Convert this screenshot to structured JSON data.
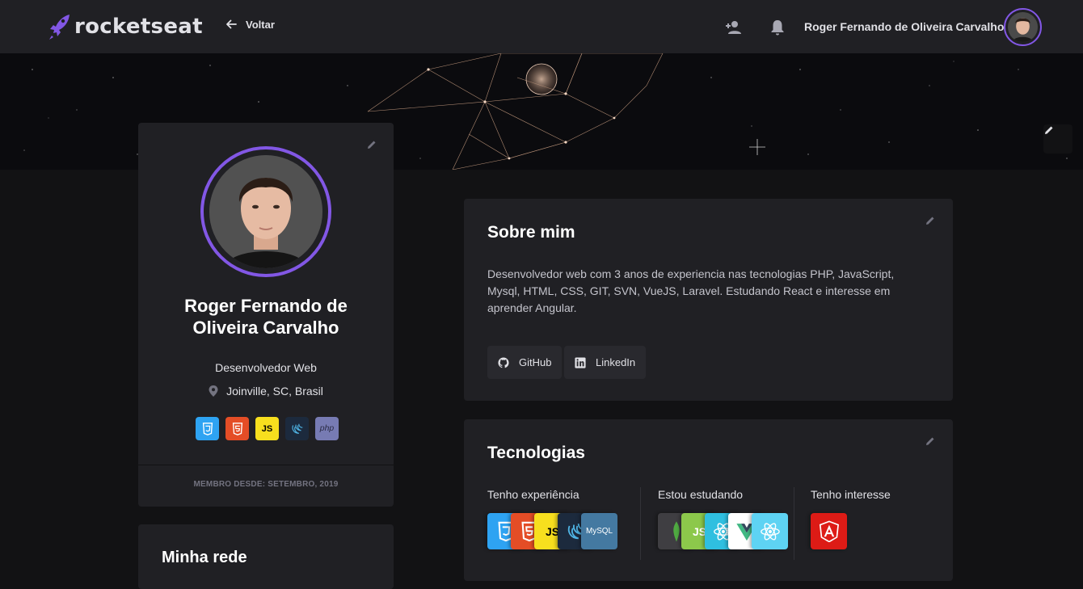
{
  "header": {
    "brand": "rocketseat",
    "back_label": "Voltar",
    "user_name": "Roger Fernando de Oliveira Carvalho",
    "accent": "#8257e5"
  },
  "banner": {
    "edit_icon": "pencil-icon"
  },
  "profile": {
    "name": "Roger Fernando de Oliveira Carvalho",
    "role": "Desenvolvedor Web",
    "location": "Joinville, SC, Brasil",
    "technologies": [
      {
        "label": "",
        "icon": "css3-icon",
        "bg": "#2ea3f2",
        "fg": "#ffffff"
      },
      {
        "label": "",
        "icon": "html5-icon",
        "bg": "#e44d26",
        "fg": "#ffffff"
      },
      {
        "label": "JS",
        "icon": "javascript-icon",
        "bg": "#f7df1e",
        "fg": "#000000"
      },
      {
        "label": "",
        "icon": "jquery-icon",
        "bg": "#1c2a3d",
        "fg": "#4fb4e4"
      },
      {
        "label": "php",
        "icon": "php-icon",
        "bg": "#777bb3",
        "fg": "#2a2b44"
      }
    ],
    "member_since": "MEMBRO DESDE: SETEMBRO, 2019"
  },
  "network": {
    "title": "Minha rede"
  },
  "about": {
    "title": "Sobre mim",
    "text": "Desenvolvedor web com 3 anos de experiencia nas tecnologias PHP, JavaScript, Mysql, HTML, CSS, GIT, SVN, VueJS, Laravel. Estudando React e interesse em aprender Angular.",
    "links": [
      {
        "label": "GitHub",
        "icon": "github-icon"
      },
      {
        "label": "LinkedIn",
        "icon": "linkedin-icon"
      }
    ]
  },
  "technologies": {
    "title": "Tecnologias",
    "columns": [
      {
        "label": "Tenho experiência",
        "items": [
          {
            "label": "",
            "icon": "css3-icon",
            "bg": "#2ea3f2",
            "fg": "#ffffff"
          },
          {
            "label": "",
            "icon": "html5-icon",
            "bg": "#e44d26",
            "fg": "#ffffff"
          },
          {
            "label": "JS",
            "icon": "javascript-icon",
            "bg": "#f7df1e",
            "fg": "#000000"
          },
          {
            "label": "",
            "icon": "jquery-icon",
            "bg": "#1c2a3d",
            "fg": "#4fb4e4"
          },
          {
            "label": "MySQL",
            "icon": "mysql-icon",
            "bg": "#4479a1",
            "fg": "#ffffff"
          }
        ]
      },
      {
        "label": "Estou estudando",
        "items": [
          {
            "label": "",
            "icon": "mongodb-icon",
            "bg": "#3f3e42",
            "fg": "#4faa41"
          },
          {
            "label": "JS",
            "icon": "nodejs-icon",
            "bg": "#8cc84b",
            "fg": "#ffffff"
          },
          {
            "label": "",
            "icon": "react-icon",
            "bg": "#2fbfe0",
            "fg": "#ffffff"
          },
          {
            "label": "",
            "icon": "vuejs-icon",
            "bg": "#ffffff",
            "fg": "#41b883"
          },
          {
            "label": "",
            "icon": "react-icon",
            "bg": "#5ed3f3",
            "fg": "#ffffff"
          }
        ]
      },
      {
        "label": "Tenho interesse",
        "items": [
          {
            "label": "",
            "icon": "angular-icon",
            "bg": "#dd1b16",
            "fg": "#ffffff"
          }
        ]
      }
    ]
  }
}
